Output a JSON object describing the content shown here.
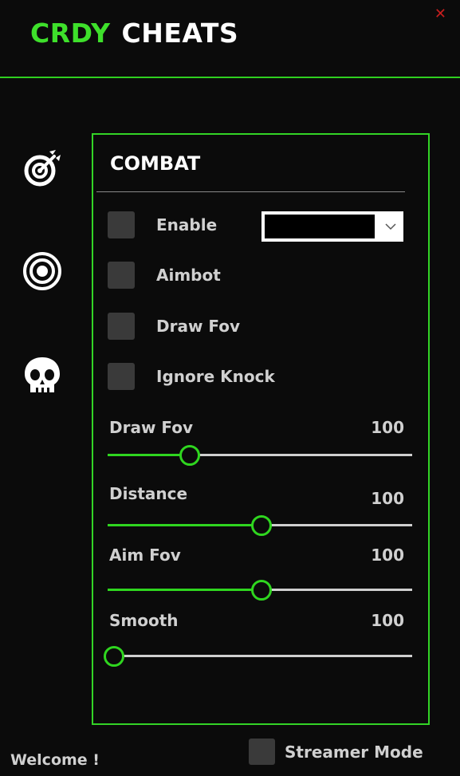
{
  "header": {
    "brand": "CRDY",
    "title_rest": "CHEATS",
    "close_label": "✕"
  },
  "nav": [
    {
      "name": "target-icon"
    },
    {
      "name": "eye-icon"
    },
    {
      "name": "skull-icon"
    }
  ],
  "panel": {
    "title": "COMBAT",
    "checks": [
      {
        "label": "Enable",
        "checked": false
      },
      {
        "label": "Aimbot",
        "checked": false
      },
      {
        "label": "Draw Fov",
        "checked": false
      },
      {
        "label": "Ignore Knock",
        "checked": false
      }
    ],
    "dropdown": {
      "value": ""
    },
    "sliders": [
      {
        "label": "Draw Fov",
        "value": "100",
        "level": 0.27
      },
      {
        "label": "Distance",
        "value": "100",
        "level": 0.505
      },
      {
        "label": "Aim Fov",
        "value": "100",
        "level": 0.505
      },
      {
        "label": "Smooth",
        "value": "100",
        "level": 0.02
      }
    ]
  },
  "footer": {
    "welcome": "Welcome !",
    "streamer_mode": "Streamer Mode",
    "streamer_checked": false
  },
  "colors": {
    "accent": "#33d426",
    "background": "#0b0b0b",
    "close": "#c81e1e"
  }
}
